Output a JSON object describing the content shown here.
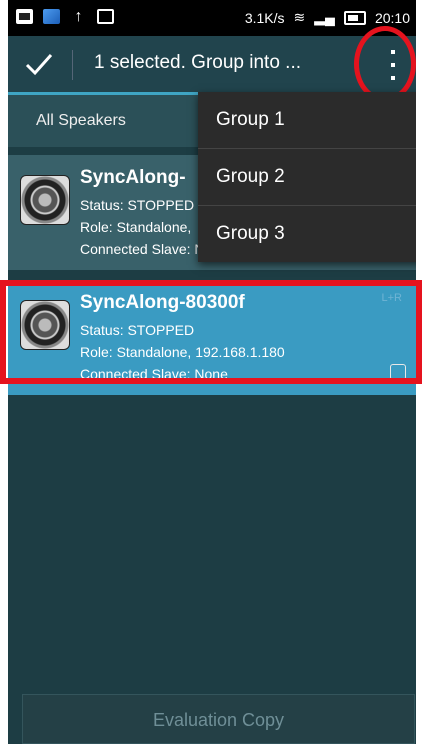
{
  "status_bar": {
    "icons_left": [
      "image-icon",
      "photo-icon",
      "upload-arrow-icon",
      "bag-icon"
    ],
    "speed": "3.1K/s",
    "time": "20:10"
  },
  "action_bar": {
    "title": "1 selected. Group into ...",
    "done_icon": "check-icon",
    "overflow_icon": "overflow-menu-icon"
  },
  "tab": {
    "label": "All Speakers"
  },
  "menu": {
    "items": [
      {
        "label": "Group 1"
      },
      {
        "label": "Group 2"
      },
      {
        "label": "Group 3"
      }
    ]
  },
  "speakers": [
    {
      "name": "SyncAlong-",
      "status": "Status: STOPPED",
      "role": "Role: Standalone,",
      "slave": "Connected Slave: None",
      "checked": false
    },
    {
      "name": "SyncAlong-80300f",
      "status": "Status: STOPPED",
      "role": "Role: Standalone,  192.168.1.180",
      "slave": "Connected Slave: None",
      "badge": "L+R",
      "checked": true
    }
  ],
  "footer": {
    "button_label": "Evaluation Copy"
  },
  "colors": {
    "accent": "#3fa5c4",
    "selected_row": "#3a9bc2",
    "highlight": "#e5131e"
  }
}
